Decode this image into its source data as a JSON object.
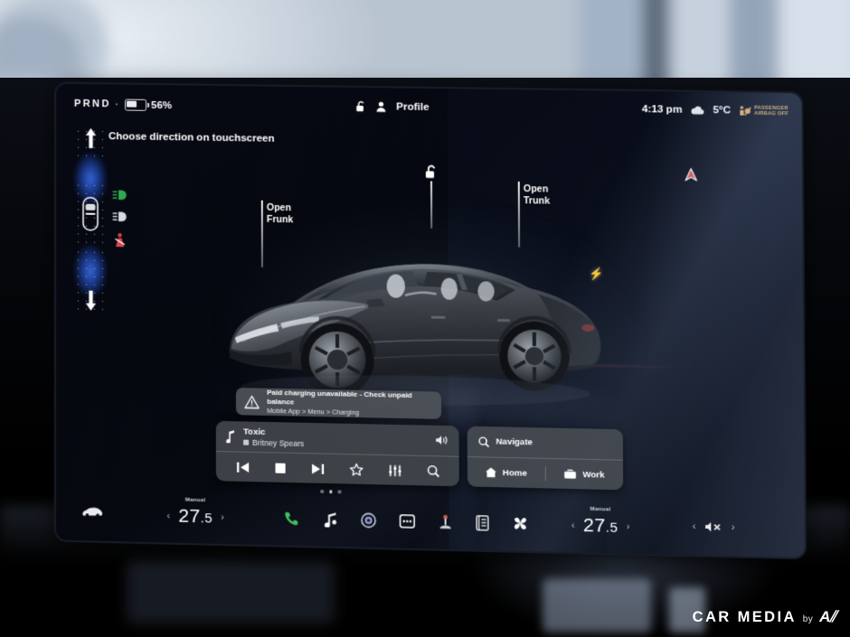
{
  "status_bar": {
    "gear": "PRND",
    "battery_percent": "56%",
    "battery_level": 56,
    "lock_icon": "unlocked-padlock-icon",
    "profile_icon": "person-icon",
    "profile_label": "Profile",
    "time": "4:13 pm",
    "weather_icon": "cloud-icon",
    "temperature": "5°C",
    "airbag_line1": "PASSENGER",
    "airbag_line2": "AIRBAG OFF",
    "airbag_color": "#e3b268"
  },
  "left_controls": {
    "hint": "Choose direction on touchscreen",
    "forward_icon": "arrow-up-icon",
    "car_select_icon": "car-top-view-icon",
    "reverse_icon": "arrow-down-icon",
    "indicators": [
      {
        "name": "low-beam-headlight-icon",
        "color": "#3fae5c"
      },
      {
        "name": "auto-headlight-icon",
        "color": "#d7dbe2"
      },
      {
        "name": "seatbelt-warning-icon",
        "color": "#d9434b"
      }
    ]
  },
  "car_view": {
    "frunk_label": "Open\nFrunk",
    "frunk_label_line1": "Open",
    "frunk_label_line2": "Frunk",
    "trunk_label_line1": "Open",
    "trunk_label_line2": "Trunk",
    "lock_icon": "unlocked-padlock-icon",
    "charge_port_icon": "lightning-bolt-icon",
    "vehicle": "Tesla Model 3",
    "body_color": "#3a3f46"
  },
  "alert": {
    "icon": "warning-triangle-icon",
    "line1": "Paid charging unavailable - Check unpaid balance",
    "line2": "Mobile App > Menu > Charging"
  },
  "media_card": {
    "source_icon": "music-note-icon",
    "title": "Toxic",
    "artist": "Britney Spears",
    "volume_icon": "volume-icon",
    "controls": [
      {
        "name": "previous-track-button",
        "icon": "skip-previous-icon"
      },
      {
        "name": "stop-button",
        "icon": "stop-square-icon"
      },
      {
        "name": "next-track-button",
        "icon": "skip-next-icon"
      },
      {
        "name": "favorite-button",
        "icon": "star-icon"
      },
      {
        "name": "equalizer-button",
        "icon": "sliders-icon"
      },
      {
        "name": "search-media-button",
        "icon": "magnifier-icon"
      }
    ]
  },
  "navigate_card": {
    "search_icon": "magnifier-icon",
    "search_label": "Navigate",
    "home_icon": "house-icon",
    "home_label": "Home",
    "work_icon": "briefcase-icon",
    "work_label": "Work"
  },
  "map": {
    "current_position_icon": "navigation-arrow-icon",
    "arrow_color": "#e2564c"
  },
  "bottom_bar": {
    "car_icon": "car-front-icon",
    "climate_left": {
      "mode": "Manual",
      "value": "27",
      "decimal": ".5",
      "left_chevron": "‹",
      "right_chevron": "›"
    },
    "climate_right": {
      "mode": "Manual",
      "value": "27",
      "decimal": ".5",
      "left_chevron": "‹",
      "right_chevron": "›"
    },
    "apps": [
      {
        "name": "phone-button",
        "icon": "phone-icon",
        "color": "#3fbf5f"
      },
      {
        "name": "media-button",
        "icon": "music-note-icon",
        "color": "#ffffff"
      },
      {
        "name": "camera-button",
        "icon": "camera-lens-icon",
        "color": "#c8c9e8"
      },
      {
        "name": "more-apps-button",
        "icon": "dots-box-icon",
        "color": "#ffffff"
      },
      {
        "name": "arcade-button",
        "icon": "joystick-icon",
        "color": "#d8d8d8"
      },
      {
        "name": "theater-button",
        "icon": "card-info-icon",
        "color": "#e6e6e6"
      },
      {
        "name": "fan-button",
        "icon": "fan-icon",
        "color": "#ffffff"
      }
    ],
    "volume": {
      "icon": "volume-muted-icon",
      "left_chevron": "‹",
      "right_chevron": "›"
    }
  },
  "page_indicator": {
    "count": 3,
    "active_index": 1
  },
  "watermark": {
    "main": "CAR MEDIA",
    "by": "by",
    "logo": "A⫽"
  }
}
